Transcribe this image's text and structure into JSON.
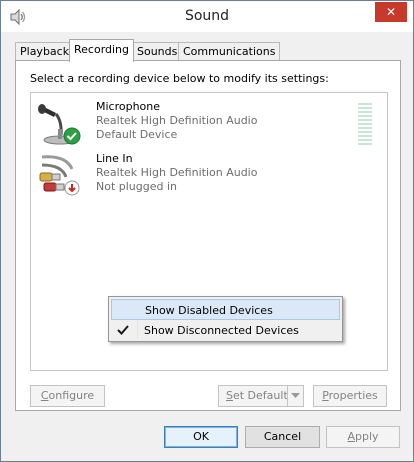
{
  "window": {
    "title": "Sound",
    "close_symbol": "✕"
  },
  "tabs": [
    {
      "label": "Playback"
    },
    {
      "label": "Recording"
    },
    {
      "label": "Sounds"
    },
    {
      "label": "Communications"
    }
  ],
  "active_tab": "Recording",
  "instruction": "Select a recording device below to modify its settings:",
  "devices": [
    {
      "name": "Microphone",
      "driver": "Realtek High Definition Audio",
      "status": "Default Device",
      "icon": "microphone-icon",
      "badge": "default-check-badge"
    },
    {
      "name": "Line In",
      "driver": "Realtek High Definition Audio",
      "status": "Not plugged in",
      "icon": "line-in-cable-icon",
      "badge": "unplugged-badge"
    }
  ],
  "context_menu": {
    "items": [
      {
        "label": "Show Disabled Devices",
        "checked": false
      },
      {
        "label": "Show Disconnected Devices",
        "checked": true
      }
    ]
  },
  "panel_buttons": {
    "configure_prefix": "",
    "configure_mnemonic": "C",
    "configure_rest": "onfigure",
    "set_default_mnemonic": "S",
    "set_default_rest": "et Default",
    "properties_mnemonic": "P",
    "properties_rest": "roperties"
  },
  "dialog_buttons": {
    "ok": "OK",
    "cancel": "Cancel",
    "apply_mnemonic": "A",
    "apply_rest": "pply"
  },
  "colors": {
    "accent": "#3c7fb1",
    "close": "#c7392b",
    "menu_highlight": "#dbe8f8",
    "level_meter": "#c9e6d8"
  }
}
